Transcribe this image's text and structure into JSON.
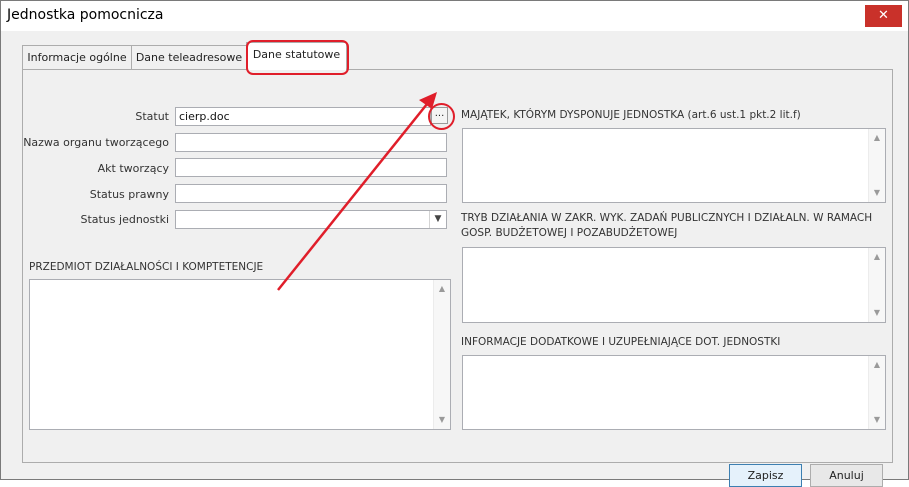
{
  "window": {
    "title": "Jednostka pomocnicza",
    "close_glyph": "✕"
  },
  "tabs": [
    {
      "label": "Informacje ogólne"
    },
    {
      "label": "Dane teleadresowe"
    },
    {
      "label": "Dane statutowe",
      "active": true
    }
  ],
  "form": {
    "statut_label": "Statut",
    "statut_value": "cierp.doc",
    "browse_label": "...",
    "nazwa_label": "Nazwa organu tworzącego",
    "nazwa_value": "",
    "akt_label": "Akt tworzący",
    "akt_value": "",
    "status_prawny_label": "Status prawny",
    "status_prawny_value": "",
    "status_jednostki_label": "Status jednostki",
    "status_jednostki_value": ""
  },
  "sections": {
    "przedmiot": "PRZEDMIOT DZIAŁALNOŚCI I KOMPTETENCJE",
    "majatek": "MAJĄTEK, KTÓRYM DYSPONUJE JEDNOSTKA (art.6 ust.1 pkt.2 lit.f)",
    "tryb_line1": "TRYB DZIAŁANIA W ZAKR. WYK. ZADAŃ PUBLICZNYCH I DZIAŁALN. W RAMACH",
    "tryb_line2": "GOSP. BUDŻETOWEJ I POZABUDŻETOWEJ",
    "informacje": "INFORMACJE DODATKOWE I UZUPEŁNIAJĄCE DOT. JEDNOSTKI"
  },
  "buttons": {
    "save": "Zapisz",
    "cancel": "Anuluj"
  },
  "icons": {
    "scroll_up": "▲",
    "scroll_down": "▼",
    "dropdown": "▼"
  },
  "colors": {
    "highlight": "#e01e2a",
    "close": "#c9312a",
    "primary_border": "#3c7fb1"
  }
}
